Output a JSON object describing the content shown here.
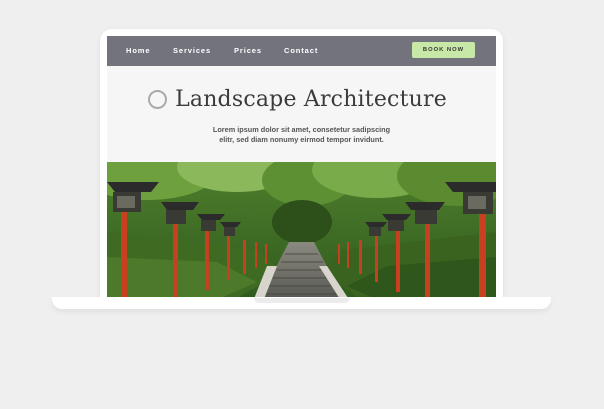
{
  "nav": {
    "links": [
      "Home",
      "Services",
      "Prices",
      "Contact"
    ],
    "cta": "BOOK NOW"
  },
  "hero": {
    "title": "Landscape Architecture",
    "tagline_line1": "Lorem ipsum dolor sit amet, consetetur sadipscing",
    "tagline_line2": "elitr, sed diam nonumy eirmod tempor invidunt.",
    "image_alt": "stone-stairway-with-red-lanterns-photo"
  },
  "colors": {
    "navbar": "#72737d",
    "cta": "#c7e8a6",
    "page_bg": "#efefef",
    "lantern_red": "#c8401f"
  },
  "icons": {
    "title_icon": "circle-outline-icon"
  }
}
